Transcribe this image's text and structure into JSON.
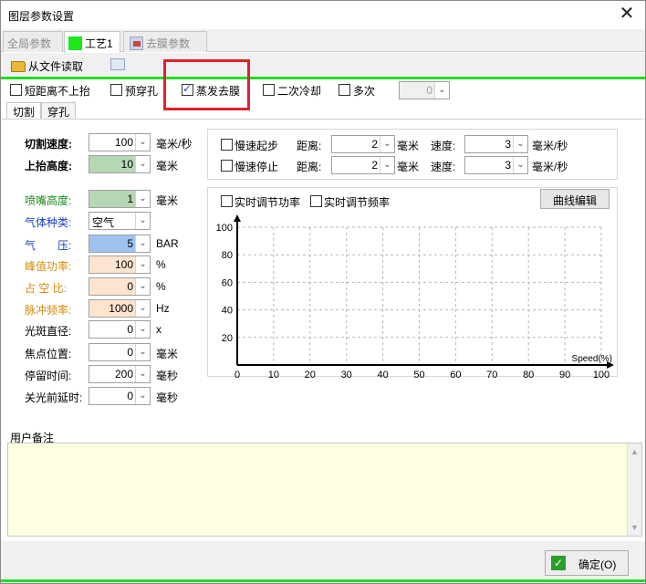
{
  "window": {
    "title": "图层参数设置"
  },
  "doc_tabs": [
    {
      "label": "全局参数"
    },
    {
      "label": "工艺1"
    },
    {
      "label": "去膜参数"
    }
  ],
  "toolbar": {
    "read_file": "从文件读取"
  },
  "options": {
    "short_no_lift": "短距离不上抬",
    "pre_pierce": "预穿孔",
    "evap_film": "蒸发去膜",
    "second_cool": "二次冷却",
    "multi": "多次",
    "multi_value": "0"
  },
  "sub_tabs": [
    {
      "label": "切割"
    },
    {
      "label": "穿孔"
    }
  ],
  "params": {
    "cut_speed": {
      "label": "切割速度:",
      "value": "100",
      "unit": "毫米/秒"
    },
    "lift_height": {
      "label": "上抬高度:",
      "value": "10",
      "unit": "毫米"
    },
    "nozzle_height": {
      "label": "喷嘴高度:",
      "value": "1",
      "unit": "毫米"
    },
    "gas_type": {
      "label": "气体种类:",
      "value": "空气"
    },
    "gas_pressure": {
      "label": "气　　压:",
      "value": "5",
      "unit": "BAR"
    },
    "peak_power": {
      "label": "峰值功率:",
      "value": "100",
      "unit": "%"
    },
    "duty_ratio": {
      "label": "占 空 比:",
      "value": "0",
      "unit": "%"
    },
    "pulse_freq": {
      "label": "脉冲频率:",
      "value": "1000",
      "unit": "Hz"
    },
    "spot_diameter": {
      "label": "光斑直径:",
      "value": "0",
      "unit": "x"
    },
    "focus_pos": {
      "label": "焦点位置:",
      "value": "0",
      "unit": "毫米"
    },
    "dwell_time": {
      "label": "停留时间:",
      "value": "200",
      "unit": "毫秒"
    },
    "off_delay": {
      "label": "关光前延时:",
      "value": "0",
      "unit": "毫秒"
    }
  },
  "slow": {
    "start_label": "慢速起步",
    "stop_label": "慢速停止",
    "distance_label": "距离:",
    "speed_label": "速度:",
    "start_distance": "2",
    "stop_distance": "2",
    "start_speed": "3",
    "stop_speed": "3",
    "distance_unit": "毫米",
    "speed_unit": "毫米/秒"
  },
  "curve": {
    "rt_power": "实时调节功率",
    "rt_freq": "实时调节频率",
    "edit_button": "曲线编辑"
  },
  "chart_data": {
    "type": "line",
    "xlabel": "Speed(%)",
    "ylabel": "",
    "x_ticks": [
      "0",
      "10",
      "20",
      "30",
      "40",
      "50",
      "60",
      "70",
      "80",
      "90",
      "100"
    ],
    "y_ticks": [
      "20",
      "40",
      "60",
      "80",
      "100"
    ],
    "xlim": [
      0,
      100
    ],
    "ylim": [
      0,
      100
    ],
    "grid": true,
    "series": []
  },
  "notes": {
    "label": "用户备注",
    "value": ""
  },
  "footer": {
    "ok_label": "确定(O)"
  },
  "colors": {
    "accent_green": "#22dd22",
    "highlight_red": "#e3202a",
    "notes_bg": "#ffffe1"
  }
}
